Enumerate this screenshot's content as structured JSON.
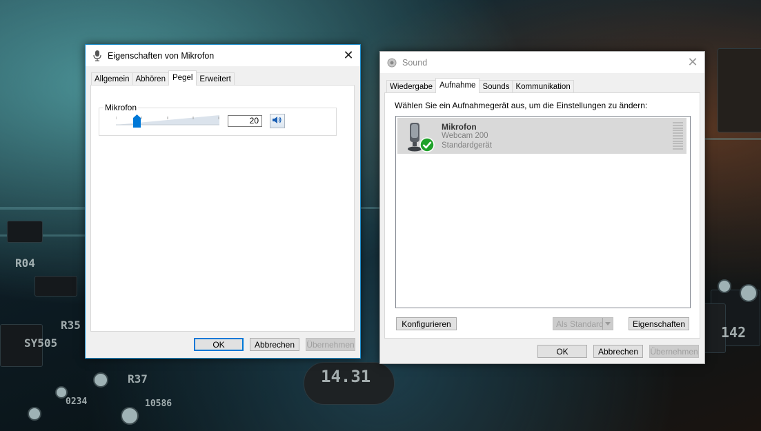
{
  "mic_props": {
    "title": "Eigenschaften von Mikrofon",
    "tabs": [
      "Allgemein",
      "Abhören",
      "Pegel",
      "Erweitert"
    ],
    "selected_tab": "Pegel",
    "level_group_label": "Mikrofon",
    "level_value": "20",
    "buttons": {
      "ok": "OK",
      "cancel": "Abbrechen",
      "apply": "Übernehmen"
    }
  },
  "sound": {
    "title": "Sound",
    "tabs": [
      "Wiedergabe",
      "Aufnahme",
      "Sounds",
      "Kommunikation"
    ],
    "selected_tab": "Aufnahme",
    "instruction": "Wählen Sie ein Aufnahmegerät aus, um die Einstellungen zu ändern:",
    "devices": [
      {
        "name": "Mikrofon",
        "model": "Webcam 200",
        "status": "Standardgerät"
      }
    ],
    "buttons": {
      "configure": "Konfigurieren",
      "set_default": "Als Standard",
      "properties": "Eigenschaften",
      "ok": "OK",
      "cancel": "Abbrechen",
      "apply": "Übernehmen"
    }
  },
  "background": {
    "labels": [
      "R04",
      "R35",
      "R37",
      "SY505",
      "0234",
      "10586",
      "14.31",
      "142"
    ]
  },
  "colors": {
    "accent": "#0078d7",
    "active_border": "#1f8ecd",
    "check_green": "#1fa12a"
  }
}
